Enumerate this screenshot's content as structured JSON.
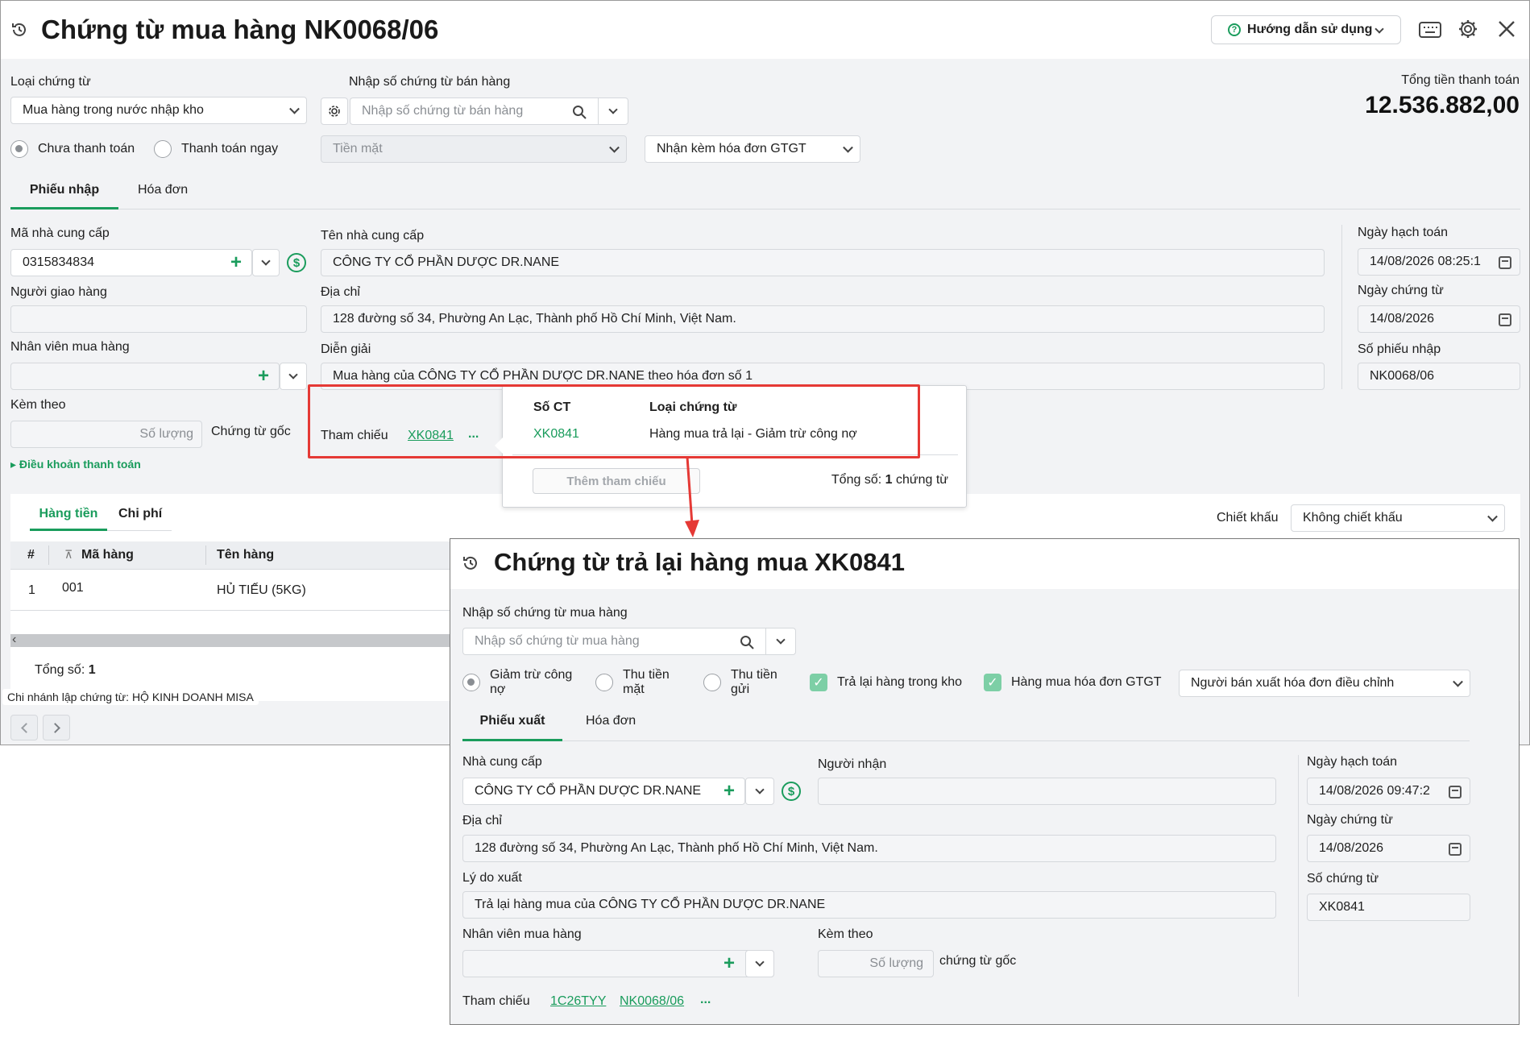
{
  "main": {
    "title": "Chứng từ mua hàng NK0068/06",
    "help_label": "Hướng dẫn sử dụng",
    "voucher_type_label": "Loại chứng từ",
    "voucher_type_value": "Mua hàng trong nước nhập kho",
    "sales_voucher_label": "Nhập số chứng từ bán hàng",
    "sales_voucher_placeholder": "Nhập số chứng từ bán hàng",
    "total_label": "Tổng tiền thanh toán",
    "total_value": "12.536.882,00",
    "payment_unpaid": "Chưa thanh toán",
    "payment_now": "Thanh toán ngay",
    "payment_method": "Tiền mặt",
    "invoice_option": "Nhận kèm hóa đơn GTGT",
    "tabs": [
      "Phiếu nhập",
      "Hóa đơn"
    ],
    "supplier_code_label": "Mã nhà cung cấp",
    "supplier_code_value": "0315834834",
    "supplier_name_label": "Tên nhà cung cấp",
    "supplier_name_value": "CÔNG TY CỔ PHẦN DƯỢC DR.NANE",
    "deliverer_label": "Người giao hàng",
    "address_label": "Địa chỉ",
    "address_value": "128 đường số 34, Phường An Lạc, Thành phố Hồ Chí Minh, Việt Nam.",
    "buyer_label": "Nhân viên mua hàng",
    "description_label": "Diễn giải",
    "description_value": "Mua hàng của CÔNG TY CỔ PHẦN DƯỢC DR.NANE theo hóa đơn số 1",
    "attach_label": "Kèm theo",
    "quantity_placeholder": "Số lượng",
    "original_docs_label": "Chứng từ gốc",
    "reference_label": "Tham chiếu",
    "reference_link": "XK0841",
    "ellipsis": "...",
    "payment_terms_link": "Điều khoản thanh toán",
    "posting_date_label": "Ngày hạch toán",
    "posting_date_value": "14/08/2026 08:25:1",
    "voucher_date_label": "Ngày chứng từ",
    "voucher_date_value": "14/08/2026",
    "receipt_no_label": "Số phiếu nhập",
    "receipt_no_value": "NK0068/06",
    "detail_tabs": [
      "Hàng tiền",
      "Chi phí"
    ],
    "discount_label": "Chiết khấu",
    "discount_value": "Không chiết khấu",
    "table_headers": [
      "#",
      "Mã hàng",
      "Tên hàng"
    ],
    "table_rows": [
      {
        "num": "1",
        "code": "001",
        "name": "HỦ TIẾU (5KG)"
      }
    ],
    "total_count_label": "Tổng số:",
    "total_count_value": "1",
    "branch_label": "Chi nhánh lập chứng từ: HỘ KINH DOANH MISA"
  },
  "popup": {
    "col_voucher_no": "Số CT",
    "col_voucher_type": "Loại chứng từ",
    "row_voucher_no": "XK0841",
    "row_voucher_type": "Hàng mua trả lại - Giảm trừ công nợ",
    "add_button": "Thêm tham chiếu",
    "total_label": "Tổng số:",
    "total_value": "1",
    "total_unit": "chứng từ"
  },
  "return": {
    "title": "Chứng từ trả lại hàng mua XK0841",
    "purchase_voucher_label": "Nhập số chứng từ mua hàng",
    "purchase_voucher_placeholder": "Nhập số chứng từ mua hàng",
    "opt_debt_reduction": "Giảm trừ công nợ",
    "opt_cash_refund": "Thu tiền mặt",
    "opt_deposit_refund": "Thu tiền gửi",
    "opt_return_stock": "Trả lại hàng trong kho",
    "opt_vat_invoice": "Hàng mua hóa đơn GTGT",
    "invoice_adjust": "Người bán xuất hóa đơn điều chỉnh",
    "tabs": [
      "Phiếu xuất",
      "Hóa đơn"
    ],
    "supplier_label": "Nhà cung cấp",
    "supplier_value": "CÔNG TY CỔ PHẦN DƯỢC DR.NANE",
    "receiver_label": "Người nhận",
    "address_label": "Địa chỉ",
    "address_value": "128 đường số 34, Phường An Lạc, Thành phố Hồ Chí Minh, Việt Nam.",
    "reason_label": "Lý do xuất",
    "reason_value": "Trả lại hàng mua của CÔNG TY CỔ PHẦN DƯỢC DR.NANE",
    "buyer_label": "Nhân viên mua hàng",
    "attach_label": "Kèm theo",
    "quantity_placeholder": "Số lượng",
    "original_docs_label": "chứng từ gốc",
    "reference_label": "Tham chiếu",
    "ref_links": [
      "1C26TYY",
      "NK0068/06"
    ],
    "ellipsis": "...",
    "posting_date_label": "Ngày hạch toán",
    "posting_date_value": "14/08/2026 09:47:2",
    "voucher_date_label": "Ngày chứng từ",
    "voucher_date_value": "14/08/2026",
    "voucher_no_label": "Số chứng từ",
    "voucher_no_value": "XK0841"
  },
  "colors": {
    "accent": "#1a9c5c",
    "highlight": "#e53935",
    "arrow": "#e53935"
  },
  "icons": [
    "history-icon",
    "help-circle-icon",
    "keyboard-icon",
    "gear-icon",
    "close-icon",
    "search-icon",
    "chevron-down-icon",
    "plus-icon",
    "dollar-icon",
    "calendar-icon",
    "pin-icon",
    "arrow-left-icon",
    "arrow-right-icon"
  ]
}
